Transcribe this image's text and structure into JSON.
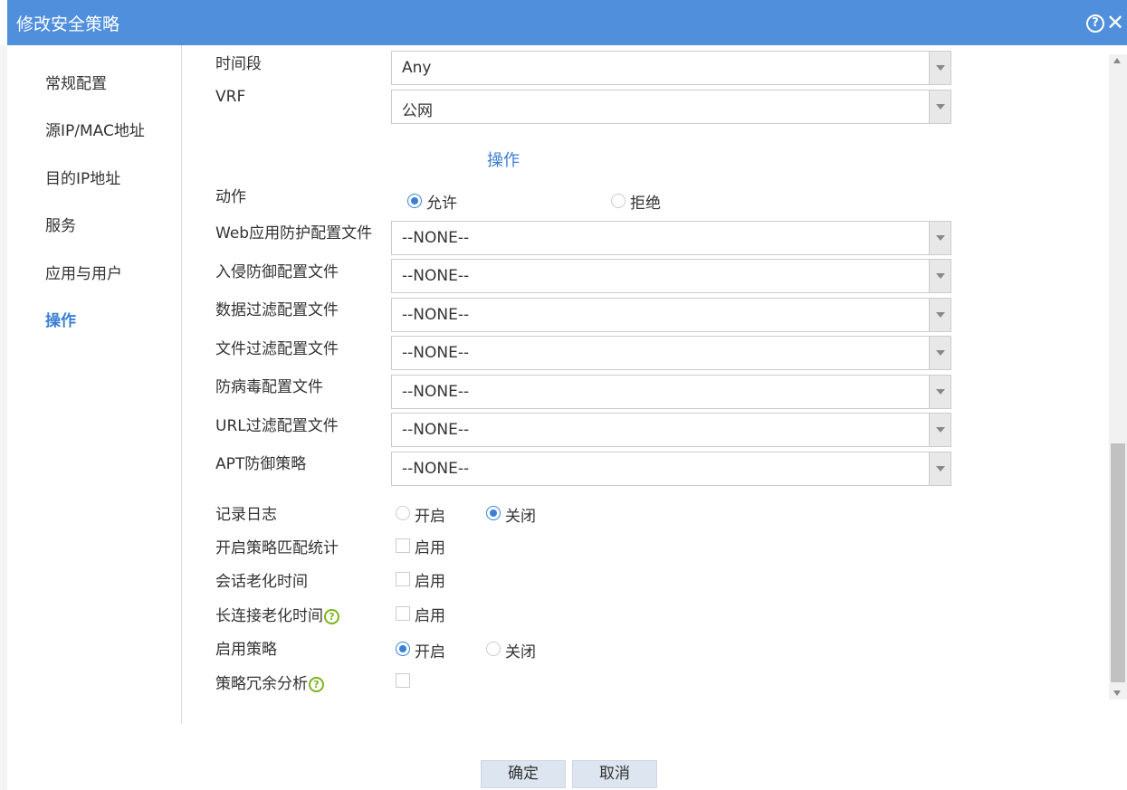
{
  "dialog": {
    "title": "修改安全策略"
  },
  "sidebar": {
    "items": [
      {
        "label": "常规配置"
      },
      {
        "label": "源IP/MAC地址"
      },
      {
        "label": "目的IP地址"
      },
      {
        "label": "服务"
      },
      {
        "label": "应用与用户"
      },
      {
        "label": "操作"
      }
    ]
  },
  "form": {
    "time_range": {
      "label": "时间段",
      "value": "Any"
    },
    "vrf": {
      "label": "VRF",
      "value": "公网"
    },
    "section_title": "操作",
    "action": {
      "label": "动作",
      "allow": "允许",
      "deny": "拒绝",
      "selected": "允许"
    },
    "profiles": [
      {
        "label": "Web应用防护配置文件",
        "value": "--NONE--"
      },
      {
        "label": "入侵防御配置文件",
        "value": "--NONE--"
      },
      {
        "label": "数据过滤配置文件",
        "value": "--NONE--"
      },
      {
        "label": "文件过滤配置文件",
        "value": "--NONE--"
      },
      {
        "label": "防病毒配置文件",
        "value": "--NONE--"
      },
      {
        "label": "URL过滤配置文件",
        "value": "--NONE--"
      },
      {
        "label": "APT防御策略",
        "value": "--NONE--"
      }
    ],
    "logging": {
      "label": "记录日志",
      "on": "开启",
      "off": "关闭",
      "selected": "关闭"
    },
    "match_stats": {
      "label": "开启策略匹配统计",
      "option": "启用",
      "checked": false
    },
    "session_aging": {
      "label": "会话老化时间",
      "option": "启用",
      "checked": false
    },
    "long_conn_aging": {
      "label": "长连接老化时间",
      "option": "启用",
      "checked": false
    },
    "enable_policy": {
      "label": "启用策略",
      "on": "开启",
      "off": "关闭",
      "selected": "开启"
    },
    "redundancy": {
      "label": "策略冗余分析",
      "checked": false
    }
  },
  "footer": {
    "ok": "确定",
    "cancel": "取消"
  },
  "colors": {
    "titlebar": "#4f8fdc",
    "accent": "#3a7fd5",
    "help_icon": "#7ab51d"
  }
}
